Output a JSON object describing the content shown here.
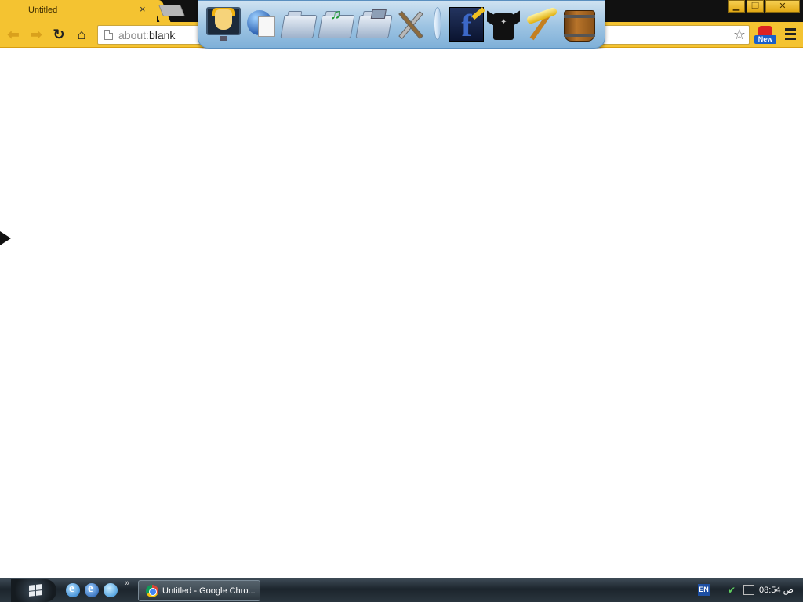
{
  "browser": {
    "tab_title": "Untitled",
    "tab_close": "×",
    "omnibox": {
      "scheme": "about:",
      "rest": "blank"
    },
    "extension_badge": "New"
  },
  "window_controls": {
    "minimize": "▁",
    "restore": "❐",
    "close": "✕"
  },
  "dock": {
    "items": [
      "naruto-monitor",
      "globe-document",
      "folder",
      "music-folder",
      "photos-folder",
      "tools",
      "separator",
      "facebook",
      "t-shirt",
      "pickaxe",
      "wooden-bucket"
    ]
  },
  "taskbar": {
    "task_label": "Untitled - Google Chro...",
    "language": "EN",
    "clock": "08:54 ص"
  },
  "colors": {
    "chrome_theme": "#f4c331",
    "tabstrip": "#111111",
    "taskbar": "#1c252d"
  }
}
